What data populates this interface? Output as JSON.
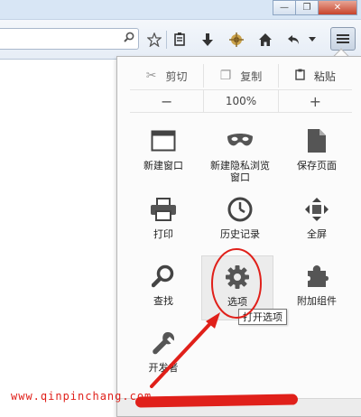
{
  "titlebar": {
    "controls": [
      "—",
      "❐",
      "✕"
    ]
  },
  "toolbar": {
    "icons": [
      "search-icon",
      "star-icon",
      "reading-list-icon",
      "download-icon",
      "addon-gift-icon",
      "home-icon",
      "back-icon",
      "dropdown-icon"
    ]
  },
  "menu": {
    "edit": {
      "cut": "剪切",
      "copy": "复制",
      "paste": "粘贴"
    },
    "zoom": {
      "minus": "−",
      "level": "100%",
      "plus": "+"
    },
    "items": [
      {
        "id": "new-window",
        "label": "新建窗口"
      },
      {
        "id": "private-window",
        "label_line1": "新建隐私浏览",
        "label_line2": "窗口"
      },
      {
        "id": "save-page",
        "label": "保存页面"
      },
      {
        "id": "print",
        "label": "打印"
      },
      {
        "id": "history",
        "label": "历史记录"
      },
      {
        "id": "fullscreen",
        "label": "全屏"
      },
      {
        "id": "find",
        "label": "查找"
      },
      {
        "id": "options",
        "label": "选项"
      },
      {
        "id": "addons",
        "label": "附加组件"
      },
      {
        "id": "developer",
        "label": "开发者"
      }
    ]
  },
  "tooltip": {
    "text": "打开选项"
  },
  "watermark": {
    "text": "www.qinpinchang.com"
  },
  "colors": {
    "annotation": "#e0201a",
    "highlight": "#ececec"
  }
}
